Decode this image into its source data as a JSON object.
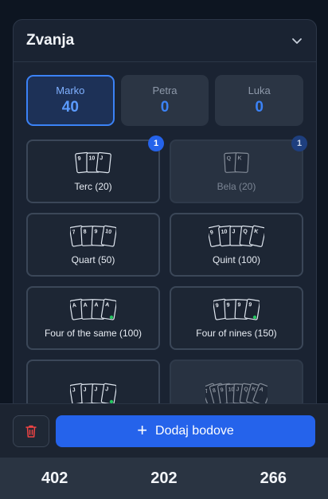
{
  "panel": {
    "title": "Zvanja"
  },
  "players": [
    {
      "name": "Marko",
      "score": "40"
    },
    {
      "name": "Petra",
      "score": "0"
    },
    {
      "name": "Luka",
      "score": "0"
    }
  ],
  "melds": [
    {
      "label": "Terc (20)",
      "badge": "1",
      "cards": [
        "9",
        "10",
        "J"
      ]
    },
    {
      "label": "Bela (20)",
      "badge": "1",
      "cards": [
        "Q",
        "K"
      ]
    },
    {
      "label": "Quart (50)",
      "cards": [
        "7",
        "8",
        "9",
        "10"
      ]
    },
    {
      "label": "Quint (100)",
      "cards": [
        "9",
        "10",
        "J",
        "Q",
        "K"
      ]
    },
    {
      "label": "Four of the same (100)",
      "cards": [
        "A",
        "A",
        "A",
        "A"
      ]
    },
    {
      "label": "Four of nines (150)",
      "cards": [
        "9",
        "9",
        "9",
        "9"
      ]
    },
    {
      "label": "",
      "cards": [
        "J",
        "J",
        "J",
        "J"
      ]
    },
    {
      "label": "",
      "cards": [
        "7",
        "8",
        "9",
        "10",
        "J",
        "Q",
        "K",
        "A"
      ]
    }
  ],
  "actions": {
    "add_label": "Dodaj bodove",
    "add_icon": "plus-icon",
    "delete_icon": "trash-icon"
  },
  "totals": [
    "402",
    "202",
    "266"
  ],
  "colors": {
    "accent": "#2563eb",
    "danger": "#ef4444",
    "dot": "#22c55e"
  }
}
